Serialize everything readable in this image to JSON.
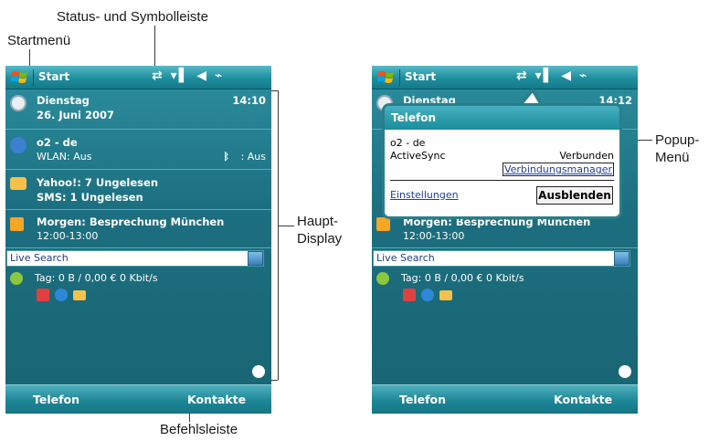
{
  "annotations": {
    "status_bar": "Status- und Symbolleiste",
    "start_menu": "Startmenü",
    "main_display_1": "Haupt-",
    "main_display_2": "Display",
    "popup_menu_1": "Popup-",
    "popup_menu_2": "Menü",
    "command_bar": "Befehlsleiste"
  },
  "left_phone": {
    "start_label": "Start",
    "date_day": "Dienstag",
    "date_full": "26. Juni 2007",
    "time": "14:10",
    "network_name": "o2 - de",
    "wlan_status": "WLAN: Aus",
    "bluetooth_status": ": Aus",
    "mail_yahoo": "Yahoo!: 7 Ungelesen",
    "mail_sms": "SMS: 1 Ungelesen",
    "calendar_title": "Morgen: Besprechung München",
    "calendar_time": "12:00-13:00",
    "search_label": "Live Search",
    "data_usage": "Tag: 0 B / 0,00 € 0 Kbit/s",
    "soft_left": "Telefon",
    "soft_right": "Kontakte"
  },
  "right_phone": {
    "start_label": "Start",
    "date_day": "Dienstag",
    "time": "14:12",
    "calendar_title": "Morgen: Besprechung München",
    "calendar_time": "12:00-13:00",
    "search_label": "Live Search",
    "data_usage": "Tag: 0 B / 0,00 € 0 Kbit/s",
    "soft_left": "Telefon",
    "soft_right": "Kontakte"
  },
  "popup": {
    "title": "Telefon",
    "network": "o2 - de",
    "activesync": "ActiveSync",
    "status": "Verbunden",
    "conn_manager": "Verbindungsmanager",
    "settings": "Einstellungen",
    "hide": "Ausblenden"
  },
  "colors": {
    "accent": "#1b6f80",
    "link": "#1f3f9a"
  }
}
